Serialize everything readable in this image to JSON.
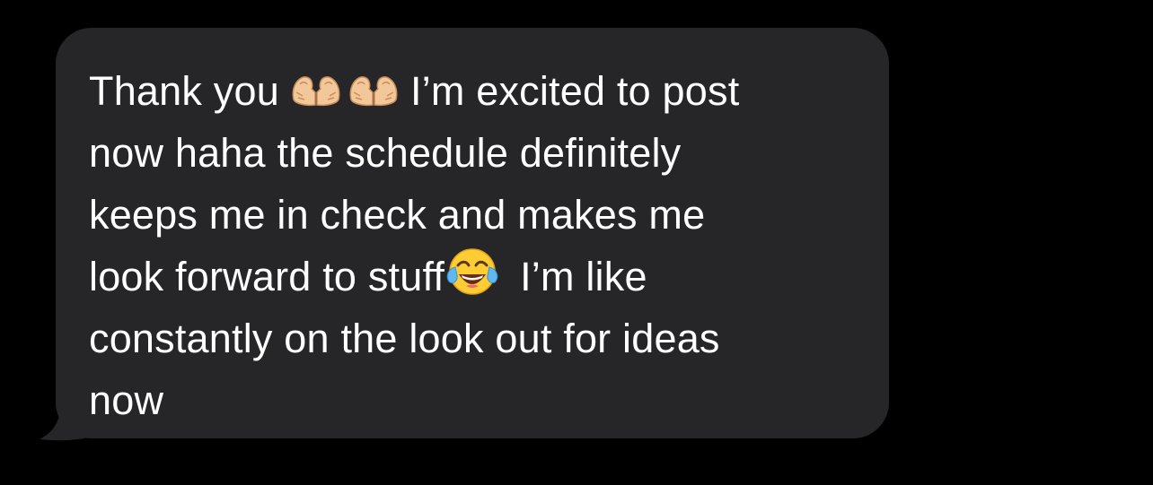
{
  "conversation": {
    "message": {
      "sender": "received",
      "bubble_color": "#262628",
      "text_color": "#ffffff",
      "background_color": "#000000",
      "line_1_a": "Thank you",
      "line_1_emoji": [
        "heart-hands",
        "heart-hands"
      ],
      "line_1_b": "I’m excited to post",
      "line_2": "now haha the schedule definitely",
      "line_3": "keeps me in check and makes me",
      "line_4_a": "look forward to stuff",
      "line_4_emoji": "face-with-tears-of-joy",
      "line_4_b": "I’m like",
      "line_5": "constantly on the look out for ideas",
      "line_6": "now"
    }
  }
}
